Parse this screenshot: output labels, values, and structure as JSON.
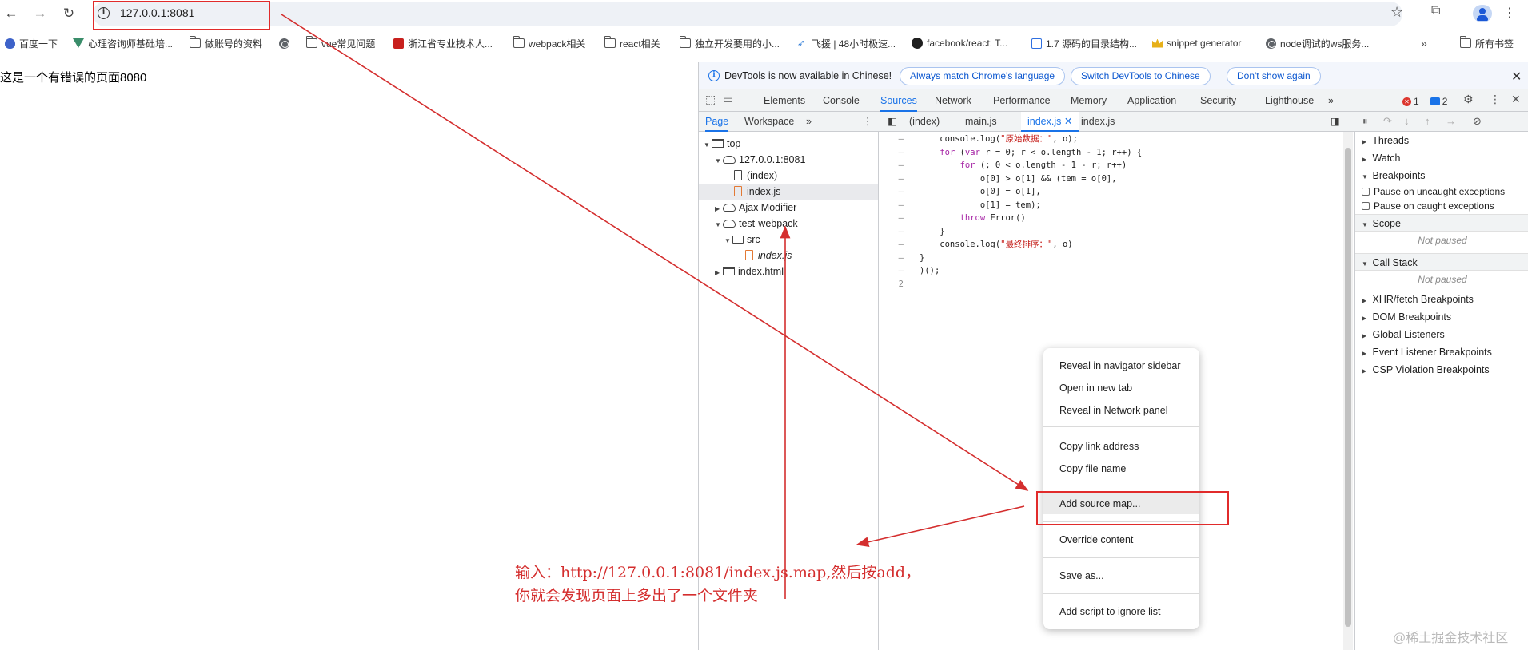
{
  "browser": {
    "url": "127.0.0.1:8081",
    "bookmarks": [
      {
        "label": "百度一下",
        "icon": "paw-icon"
      },
      {
        "label": "心理咨询师基础培...",
        "icon": "vue-icon"
      },
      {
        "label": "做账号的资料",
        "icon": "folder-icon"
      },
      {
        "label": "",
        "icon": "globe-icon"
      },
      {
        "label": "vue常见问题",
        "icon": "folder-icon"
      },
      {
        "label": "浙江省专业技术人...",
        "icon": "red-logo-icon"
      },
      {
        "label": "webpack相关",
        "icon": "folder-icon"
      },
      {
        "label": "react相关",
        "icon": "folder-icon"
      },
      {
        "label": "独立开发要用的小...",
        "icon": "folder-icon"
      },
      {
        "label": "飞援 | 48小时极速...",
        "icon": "fly-icon"
      },
      {
        "label": "facebook/react: T...",
        "icon": "github-icon"
      },
      {
        "label": "1.7 源码的目录结构...",
        "icon": "calendar-icon"
      },
      {
        "label": "snippet generator",
        "icon": "crown-icon"
      },
      {
        "label": "node调试的ws服务...",
        "icon": "globe-icon"
      }
    ],
    "bookmarks_more": "»",
    "all_bookmarks": "所有书签"
  },
  "page": {
    "text": "这是一个有错误的页面8080"
  },
  "devtools": {
    "banner": {
      "text": "DevTools is now available in Chinese!",
      "btn_match": "Always match Chrome's language",
      "btn_switch": "Switch DevTools to Chinese",
      "btn_dont": "Don't show again"
    },
    "tabs": [
      "Elements",
      "Console",
      "Sources",
      "Network",
      "Performance",
      "Memory",
      "Application",
      "Security",
      "Lighthouse"
    ],
    "tabs_more": "»",
    "error_count": "1",
    "message_count": "2",
    "sub_tabs": [
      "Page",
      "Workspace"
    ],
    "sub_more": "»",
    "file_tabs": [
      "(index)",
      "main.js",
      "index.js",
      "index.js"
    ],
    "tree": [
      {
        "label": "top"
      },
      {
        "label": "127.0.0.1:8081"
      },
      {
        "label": "(index)"
      },
      {
        "label": "index.js"
      },
      {
        "label": "Ajax Modifier"
      },
      {
        "label": "test-webpack"
      },
      {
        "label": "src"
      },
      {
        "label": "index.js"
      },
      {
        "label": "index.html"
      }
    ],
    "code": [
      {
        "gutter": "–",
        "pre": "    console.log(",
        "str": "\"原始数据：\"",
        "post": ", o);"
      },
      {
        "gutter": "–",
        "pre": "    ",
        "kw": "for",
        "post": " (",
        "kw2": "var",
        "post2": " r = 0; r < o.length - 1; r++) {"
      },
      {
        "gutter": "–",
        "pre": "        ",
        "kw": "for",
        "post": " (; 0 < o.length - 1 - r; r++)"
      },
      {
        "gutter": "–",
        "pre": "            o[0] > o[1] && (tem = o[0],"
      },
      {
        "gutter": "–",
        "pre": "            o[0] = o[1],"
      },
      {
        "gutter": "–",
        "pre": "            o[1] = tem);"
      },
      {
        "gutter": "–",
        "pre": "        ",
        "kw": "throw",
        "post": " Error()"
      },
      {
        "gutter": "–",
        "pre": "    }"
      },
      {
        "gutter": "–",
        "pre": "    console.log(",
        "str": "\"最终排序：\"",
        "post": ", o)"
      },
      {
        "gutter": "–",
        "pre": "}"
      },
      {
        "gutter": "–",
        "pre": ")();"
      },
      {
        "gutter": "2",
        "pre": ""
      }
    ],
    "debugger": {
      "threads": "Threads",
      "watch": "Watch",
      "breakpoints": "Breakpoints",
      "pause_uncaught": "Pause on uncaught exceptions",
      "pause_caught": "Pause on caught exceptions",
      "scope": "Scope",
      "not_paused_1": "Not paused",
      "call_stack": "Call Stack",
      "not_paused_2": "Not paused",
      "xhr": "XHR/fetch Breakpoints",
      "dom": "DOM Breakpoints",
      "global": "Global Listeners",
      "event": "Event Listener Breakpoints",
      "csp": "CSP Violation Breakpoints"
    }
  },
  "context_menu": {
    "reveal_nav": "Reveal in navigator sidebar",
    "open_tab": "Open in new tab",
    "reveal_network": "Reveal in Network panel",
    "copy_link": "Copy link address",
    "copy_file": "Copy file name",
    "add_source_map": "Add source map...",
    "override": "Override content",
    "save_as": "Save as...",
    "ignore": "Add script to ignore list"
  },
  "annotation": {
    "line1": "输入：http://127.0.0.1:8081/index.js.map,然后按add，",
    "line2": "你就会发现页面上多出了一个文件夹",
    "color": "#d42e2e"
  },
  "watermark": "@稀土掘金技术社区"
}
